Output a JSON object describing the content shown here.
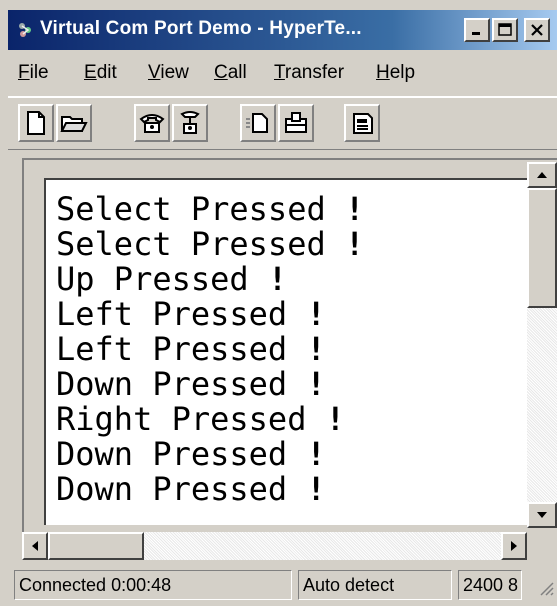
{
  "window": {
    "title": "Virtual Com Port Demo - HyperTe...",
    "controls": [
      "minimize",
      "maximize",
      "close"
    ]
  },
  "menu": {
    "items": [
      {
        "label": "File",
        "key": "F",
        "rest": "ile"
      },
      {
        "label": "Edit",
        "key": "E",
        "rest": "dit"
      },
      {
        "label": "View",
        "key": "V",
        "rest": "iew"
      },
      {
        "label": "Call",
        "key": "C",
        "rest": "all"
      },
      {
        "label": "Transfer",
        "key": "T",
        "rest": "ransfer"
      },
      {
        "label": "Help",
        "key": "H",
        "rest": "elp"
      }
    ]
  },
  "toolbar": {
    "icons": [
      "new-document-icon",
      "open-folder-icon",
      "connect-phone-icon",
      "disconnect-phone-icon",
      "send-icon",
      "receive-icon",
      "properties-icon"
    ]
  },
  "terminal": {
    "lines": [
      {
        "text": "Select Pressed",
        "suffix": "!"
      },
      {
        "text": "Select Pressed",
        "suffix": "!"
      },
      {
        "text": "Up Pressed",
        "suffix": "!"
      },
      {
        "text": "Left Pressed",
        "suffix": "!"
      },
      {
        "text": "Left Pressed",
        "suffix": "!"
      },
      {
        "text": "Down Pressed",
        "suffix": "!"
      },
      {
        "text": "Right Pressed",
        "suffix": "!"
      },
      {
        "text": "Down Pressed",
        "suffix": "!"
      },
      {
        "text": "Down Pressed",
        "suffix": "!"
      }
    ]
  },
  "status": {
    "connection": "Connected 0:00:48",
    "detect": "Auto detect",
    "baud": "2400 8"
  },
  "colors": {
    "titlebar_start": "#0a246a",
    "titlebar_end": "#a6caf0",
    "face": "#d4d0c8"
  }
}
